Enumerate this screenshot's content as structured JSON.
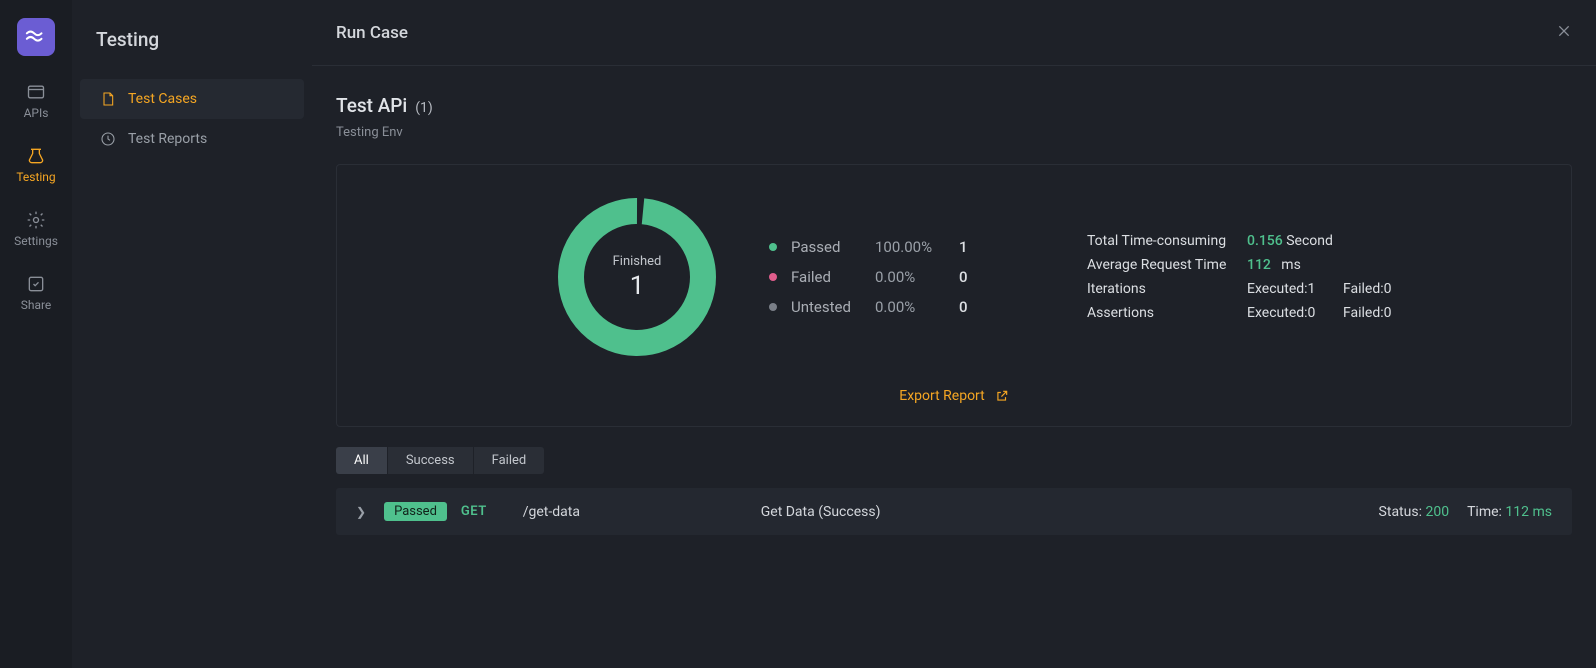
{
  "rail": {
    "items": [
      {
        "id": "apis",
        "label": "APIs"
      },
      {
        "id": "testing",
        "label": "Testing"
      },
      {
        "id": "settings",
        "label": "Settings"
      },
      {
        "id": "share",
        "label": "Share"
      }
    ]
  },
  "sidebar": {
    "title": "Testing",
    "items": [
      {
        "id": "cases",
        "label": "Test Cases"
      },
      {
        "id": "reports",
        "label": "Test Reports"
      }
    ]
  },
  "header": {
    "title": "Run Case"
  },
  "case": {
    "name": "Test APi",
    "count_display": "(1)",
    "env": "Testing Env"
  },
  "donut": {
    "label": "Finished",
    "value": "1"
  },
  "legend": {
    "passed": {
      "name": "Passed",
      "pct": "100.00%",
      "count": "1",
      "color": "#4fc08d"
    },
    "failed": {
      "name": "Failed",
      "pct": "0.00%",
      "count": "0",
      "color": "#e05d8c"
    },
    "untested": {
      "name": "Untested",
      "pct": "0.00%",
      "count": "0",
      "color": "#7a7f88"
    }
  },
  "metrics": {
    "total_time_label": "Total Time-consuming",
    "total_time_value": "0.156",
    "total_time_unit": "Second",
    "avg_time_label": "Average Request Time",
    "avg_time_value": "112",
    "avg_time_unit": "ms",
    "iterations_label": "Iterations",
    "iterations_exec": "Executed:1",
    "iterations_fail": "Failed:0",
    "assertions_label": "Assertions",
    "assertions_exec": "Executed:0",
    "assertions_fail": "Failed:0"
  },
  "export_label": "Export Report",
  "filters": {
    "all": "All",
    "success": "Success",
    "failed": "Failed"
  },
  "result": {
    "status_badge": "Passed",
    "method": "GET",
    "path": "/get-data",
    "name": "Get Data (Success)",
    "status_label": "Status:",
    "status_code": "200",
    "time_label": "Time:",
    "time_value": "112 ms"
  },
  "colors": {
    "accent": "#f5a623",
    "green": "#4fc08d"
  }
}
